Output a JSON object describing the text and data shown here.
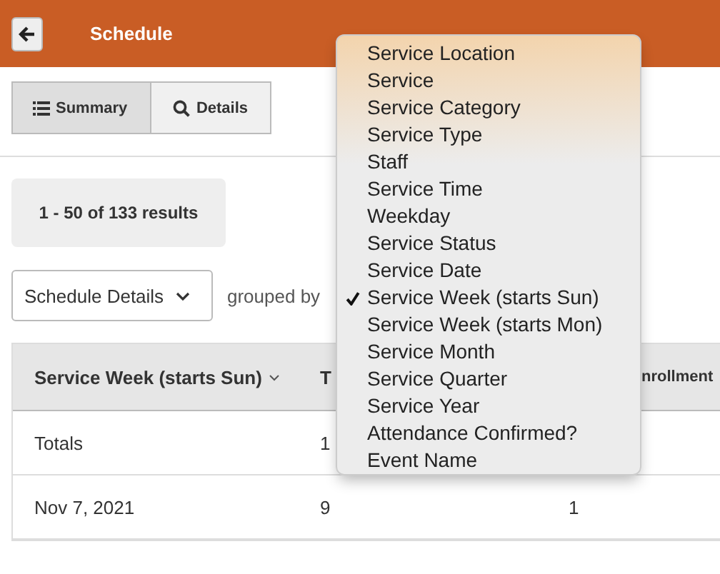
{
  "header": {
    "title": "Schedule"
  },
  "view_toggle": [
    {
      "label": "Summary",
      "selected": true
    },
    {
      "label": "Details",
      "selected": false
    }
  ],
  "results": "1 - 50 of 133 results",
  "report_select": {
    "value": "Schedule Details"
  },
  "grouped_by_label": "grouped by",
  "table": {
    "columns": [
      "Service Week (starts Sun)",
      "T",
      "nrollment"
    ],
    "rows": [
      [
        "Totals",
        "1",
        ""
      ],
      [
        "Nov 7, 2021",
        "9",
        "1"
      ]
    ]
  },
  "group_menu": [
    {
      "label": "Service Location",
      "selected": false
    },
    {
      "label": "Service",
      "selected": false
    },
    {
      "label": "Service Category",
      "selected": false
    },
    {
      "label": "Service Type",
      "selected": false
    },
    {
      "label": "Staff",
      "selected": false
    },
    {
      "label": "Service Time",
      "selected": false
    },
    {
      "label": "Weekday",
      "selected": false
    },
    {
      "label": "Service Status",
      "selected": false
    },
    {
      "label": "Service Date",
      "selected": false
    },
    {
      "label": "Service Week (starts Sun)",
      "selected": true
    },
    {
      "label": "Service Week (starts Mon)",
      "selected": false
    },
    {
      "label": "Service Month",
      "selected": false
    },
    {
      "label": "Service Quarter",
      "selected": false
    },
    {
      "label": "Service Year",
      "selected": false
    },
    {
      "label": "Attendance Confirmed?",
      "selected": false
    },
    {
      "label": "Event Name",
      "selected": false
    }
  ]
}
